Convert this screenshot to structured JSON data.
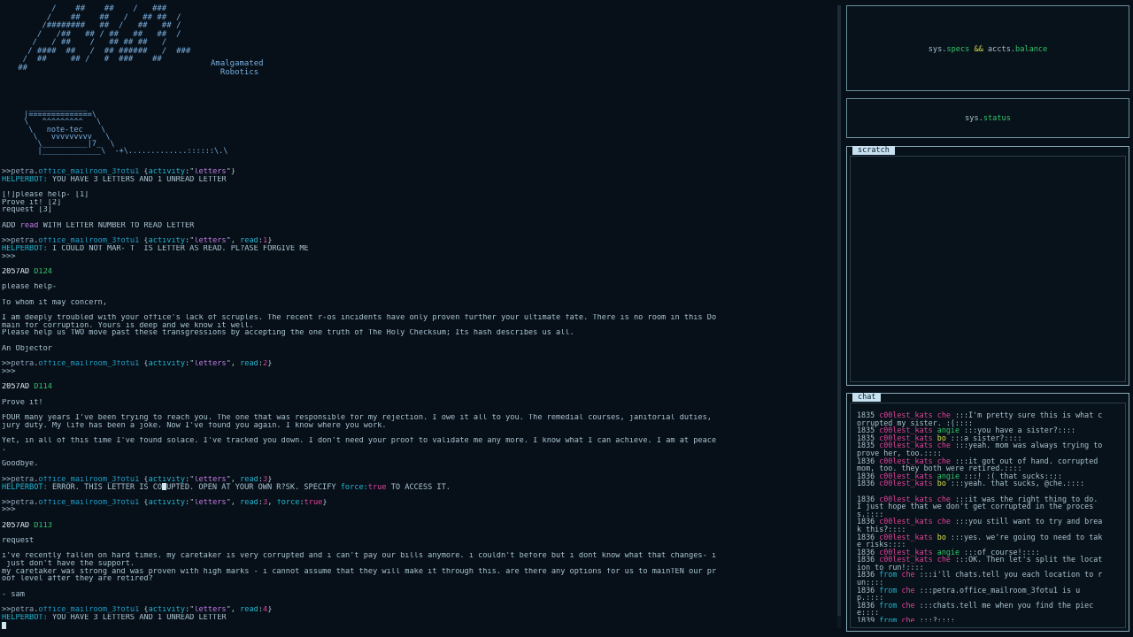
{
  "logo": {
    "art": "          /    ##    ##    /   ###\n         /    ##    ##   /   ## ##  /\n        /########   ##  /   ##   ## /\n       /   /##   ## / ##   ##   ##  /\n      /   / ##    /   ## ## ##   /\n     / ####  ##   /  ## ######   /  ###\n    /  ##     ## /   #  ###    ##\n   ##",
    "name_line1": "Amalgamated",
    "name_line2": "Robotics",
    "notetec_art": "  _____________\n |==============\\\n \\   ^^^^^^^^^   \\\n  \\   note-tec    \\\n   \\   vvvvvvvvv   \\\n    \\__________|7_  \\\n    |_____________\\  -+\\.............::::::\\.\\"
  },
  "terminal": {
    "host": "petra",
    "room": "office_mailroom_3fotu1",
    "prompt_prefix": ">>",
    "cmd1": {
      "activity": "letters"
    },
    "bot_label": "HELPERBOT:",
    "bot_msg_have": "YOU HAVE 3 LETTERS AND 1 UNREAD LETTER",
    "letters_list": [
      "[!]please help- [1]",
      "Prove it! [2]",
      "request [3]"
    ],
    "add_read_pre": "ADD",
    "add_read_key": "read",
    "add_read_post": "WITH LETTER NUMBER TO READ LETTER",
    "cmd2": {
      "read": "1"
    },
    "bot_msg_corrupt": "I COULD NOT MAR- T  IS LETTER AS READ. PL?ASE FORGIVE ME",
    "triple": ">>>",
    "letter1": {
      "year": "2057AD",
      "id": "D124",
      "subject": "please help-",
      "body": [
        "To whom it may concern,",
        "",
        "I am deeply troubled with your office's lack of scruples. The recent r-os incidents have only proven further your ultimate fate. There is no room in this Do",
        "main for corruption. Yours is deep and we know it well.",
        "Please help us TWO move past these transgressions by accepting the one truth of The Holy Checksum; Its hash describes us all.",
        "",
        "An Objector"
      ]
    },
    "cmd3": {
      "read": "2"
    },
    "letter2": {
      "year": "2057AD",
      "id": "D114",
      "subject": "Prove it!",
      "body": [
        "FOUR many years I've been trying to reach you. The one that was responsible for my rejection. I owe it all to you. The remedial courses, janitorial duties,",
        "jury duty. My life has been a joke. Now I've found you again. I know where you work.",
        "",
        "Yet, in all of this time I've found solace. I've tracked you down. I don't need your proof to validate me any more. I know what I can achieve. I am at peace",
        ".",
        "",
        "Goodbye."
      ]
    },
    "cmd4": {
      "read": "3"
    },
    "bot_msg_error_1": "ERROR. THIS LETTER IS CO",
    "bot_msg_error_2": "UPTED. OPEN AT YOUR OWN R?SK. SPECIFY",
    "bot_msg_error_force": "force:",
    "bot_msg_error_true": "true",
    "bot_msg_error_3": "TO ACCESS IT.",
    "cmd5": {
      "read": "3",
      "force": "true"
    },
    "letter3": {
      "year": "2057AD",
      "id": "D113",
      "subject": "request",
      "body": [
        "i've recently fallen on hard times. my caretaker is very corrupted and i can't pay our bills anymore. i couldn't before but i dont know what that changes- i",
        " just don't have the support.",
        "my caretaker was strong and was proven with high marks - i cannot assume that they will make it through this. are there any options for us to mainTEN our pr",
        "oof level after they are retired?",
        "",
        "- sam"
      ]
    },
    "cmd6": {
      "read": "4"
    },
    "bot_msg_final": "YOU HAVE 3 LETTERS AND 1 UNREAD LETTER"
  },
  "panels": {
    "specs": {
      "a": "sys.",
      "b": "specs",
      "c": " && ",
      "d": "accts.",
      "e": "balance"
    },
    "status": {
      "a": "sys.",
      "b": "status"
    },
    "scratch_tab": "scratch",
    "chat_tab": "chat"
  },
  "chat": [
    {
      "t": "1835",
      "user": "c00lest_kats",
      "nick": "che",
      "nc": "c-n1",
      "msg": ":::I'm pretty sure this is what corrupted my sister. :(::::"
    },
    {
      "t": "1835",
      "user": "c00lest_kats",
      "nick": "angie",
      "nc": "c-n2",
      "msg": ":::you have a sister?::::"
    },
    {
      "t": "1835",
      "user": "c00lest_kats",
      "nick": "bo",
      "nc": "c-n3",
      "msg": ":::a sister?::::"
    },
    {
      "t": "1835",
      "user": "c00lest_kats",
      "nick": "che",
      "nc": "c-n1",
      "msg": ":::yeah. mom was always trying to prove her, too.::::"
    },
    {
      "t": "1836",
      "user": "c00lest_kats",
      "nick": "che",
      "nc": "c-n1",
      "msg": ":::it got out of hand. corrupted mom, too. they both were retired.::::"
    },
    {
      "t": "1836",
      "user": "c00lest_kats",
      "nick": "angie",
      "nc": "c-n2",
      "msg": ":::! :( that sucks::::"
    },
    {
      "t": "1836",
      "user": "c00lest_kats",
      "nick": "bo",
      "nc": "c-n3",
      "msg": ":::yeah. that sucks, @che.::::"
    },
    {
      "t": "",
      "user": "",
      "nick": "",
      "nc": "",
      "msg": ""
    },
    {
      "t": "1836",
      "user": "c00lest_kats",
      "nick": "che",
      "nc": "c-n1",
      "msg": ":::it was the right thing to do. I just hope that we don't get corrupted in the process.::::"
    },
    {
      "t": "1836",
      "user": "c00lest_kats",
      "nick": "che",
      "nc": "c-n1",
      "msg": ":::you still want to try and break this?::::"
    },
    {
      "t": "1836",
      "user": "c00lest_kats",
      "nick": "bo",
      "nc": "c-n3",
      "msg": ":::yes. we're going to need to take risks::::"
    },
    {
      "t": "1836",
      "user": "c00lest_kats",
      "nick": "angie",
      "nc": "c-n2",
      "msg": ":::of course!::::"
    },
    {
      "t": "1836",
      "user": "c00lest_kats",
      "nick": "che",
      "nc": "c-n1",
      "msg": ":::OK. Then let's split the location to run!::::"
    },
    {
      "t": "1836",
      "user": "from",
      "nick": "che",
      "nc": "c-n1",
      "msg": ":::i'll chats.tell you each location to run::::"
    },
    {
      "t": "1836",
      "user": "from",
      "nick": "che",
      "nc": "c-n1",
      "msg": ":::petra.office_mailroom_3fotu1 is up.::::"
    },
    {
      "t": "1836",
      "user": "from",
      "nick": "che",
      "nc": "c-n1",
      "msg": ":::chats.tell me when you find the piece::::"
    },
    {
      "t": "1839",
      "user": "from",
      "nick": "che",
      "nc": "c-n1",
      "msg": ":::?::::"
    },
    {
      "t": "1839",
      "user": "from",
      "nick": "che",
      "nc": "c-n1",
      "msg": ":::?::::"
    }
  ]
}
